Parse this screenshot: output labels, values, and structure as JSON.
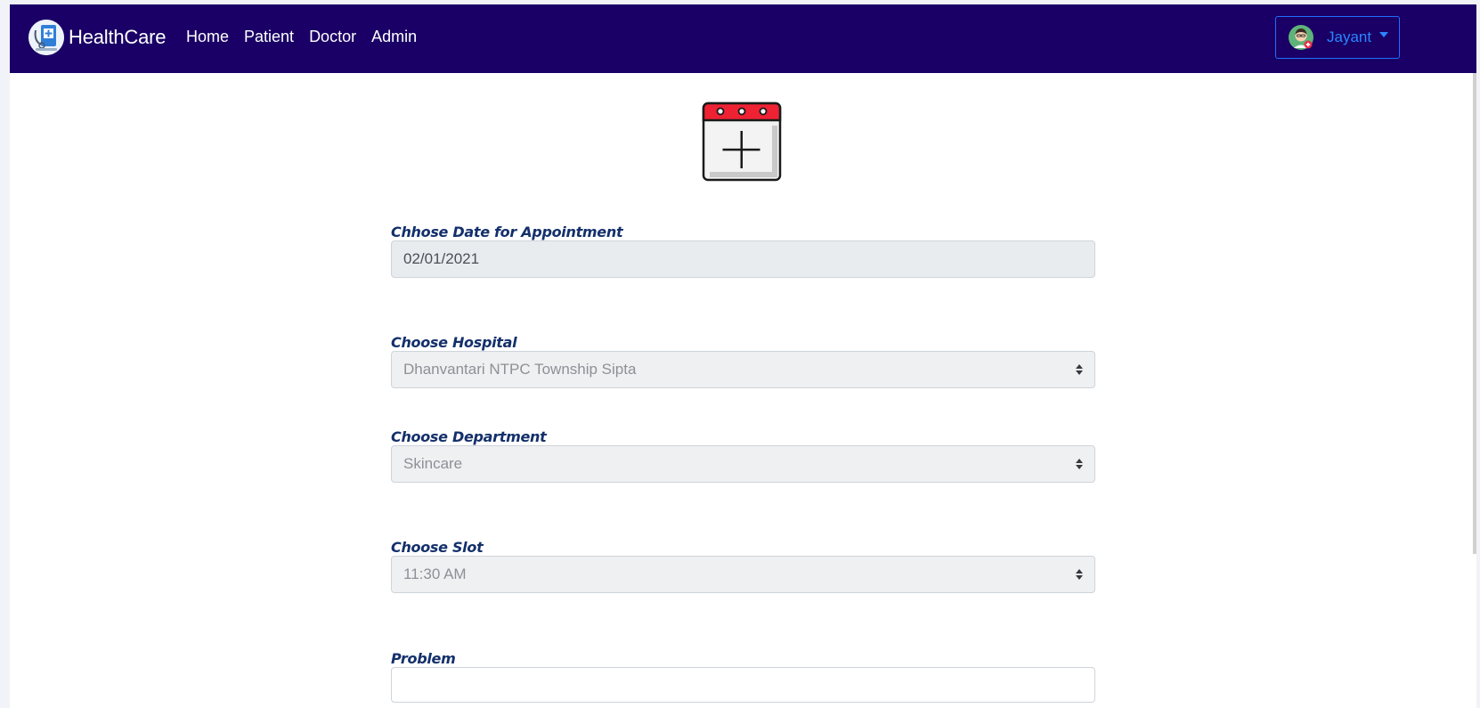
{
  "brand": {
    "name": "HealthCare"
  },
  "nav": {
    "items": [
      {
        "label": "Home"
      },
      {
        "label": "Patient"
      },
      {
        "label": "Doctor"
      },
      {
        "label": "Admin"
      }
    ]
  },
  "user_menu": {
    "name": "Jayant"
  },
  "colors": {
    "navbar": "#1a0066",
    "label": "#14306b",
    "user_accent": "#2a86ff",
    "calendar_header": "#ee2233"
  },
  "icons": {
    "brand": "healthcare-logo-icon",
    "avatar": "doctor-avatar-icon",
    "calendar": "calendar-add-icon"
  },
  "form": {
    "date": {
      "label": "Chhose Date for Appointment",
      "value": "02/01/2021"
    },
    "hospital": {
      "label": "Choose Hospital",
      "value": "Dhanvantari NTPC Township Sipta"
    },
    "department": {
      "label": "Choose Department",
      "value": "Skincare"
    },
    "slot": {
      "label": "Choose Slot",
      "value": "11:30 AM"
    },
    "problem": {
      "label": "Problem",
      "value": ""
    }
  }
}
